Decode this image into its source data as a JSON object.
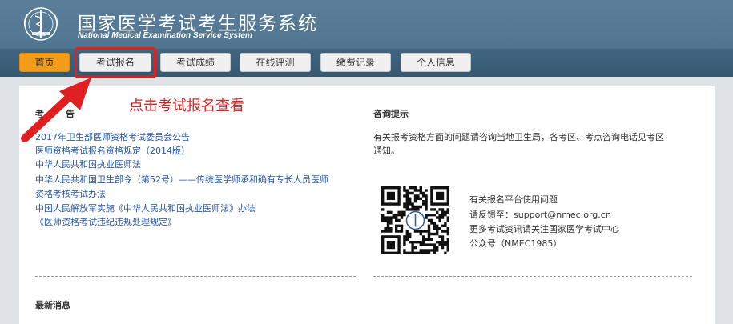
{
  "header": {
    "title": "国家医学考试考生服务系统",
    "subtitle": "National Medical Examination Service System"
  },
  "nav": {
    "tabs": [
      {
        "label": "首页",
        "active": true
      },
      {
        "label": "考试报名",
        "highlighted": true
      },
      {
        "label": "考试成绩"
      },
      {
        "label": "在线评测"
      },
      {
        "label": "缴费记录"
      },
      {
        "label": "个人信息"
      }
    ]
  },
  "annotation": {
    "text": "点击考试报名查看",
    "color": "#e02020"
  },
  "left": {
    "title_partial": "考",
    "title_tail": "告",
    "links": [
      "2017年卫生部医师资格考试委员会公告",
      "医师资格考试报名资格规定（2014版）",
      "中华人民共和国执业医师法",
      "中华人民共和国卫生部令（第52号）——传统医学师承和确有专长人员医师",
      "资格考核考试办法",
      "中国人民解放军实施《中华人民共和国执业医师法》办法",
      "《医师资格考试违纪违规处理规定》"
    ]
  },
  "right": {
    "title": "咨询提示",
    "desc_lines": [
      "有关报考资格方面的问题请咨询当地卫生局，各考区、考点咨询电话见考区",
      "通知。"
    ],
    "contact_lines": [
      "有关报名平台使用问题",
      "请反馈至：support@nmec.org.cn",
      "更多考试资讯请关注国家医学考试中心",
      "公众号（NMEC1985）"
    ]
  },
  "latest": {
    "title": "最新消息"
  },
  "colors": {
    "header_blue": "#4a6f8b",
    "accent_orange": "#f39c1a",
    "link_blue": "#2556a8",
    "annotation_red": "#e02020"
  }
}
